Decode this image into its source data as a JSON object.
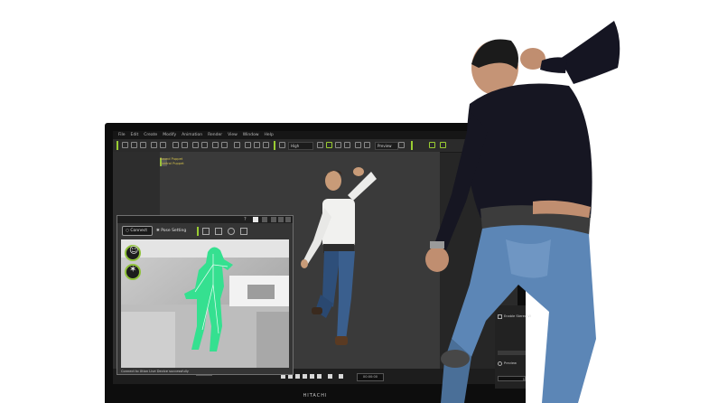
{
  "menu": [
    "File",
    "Edit",
    "Create",
    "Modify",
    "Animation",
    "Render",
    "View",
    "Window",
    "Help"
  ],
  "toolbar": {
    "quality": "High",
    "preview": "Preview"
  },
  "viewport": {
    "line1": "Bound Puppet",
    "line2": "Control Puppet"
  },
  "mocap": {
    "connect_label": "Connect",
    "pose_label": "Pose Setting",
    "status": "Connect to Xtion Live Device successfully"
  },
  "timeline": {
    "timecode": "00:00:00",
    "frame": "Image 1"
  },
  "props": {
    "option1": "Enable Stereo Vi",
    "option2": "Preview",
    "value": "1"
  },
  "monitor_brand": "HITACHI",
  "colors": {
    "accent": "#9acd32",
    "skeleton": "#35e090",
    "depth_background": "#b8b8b8"
  }
}
